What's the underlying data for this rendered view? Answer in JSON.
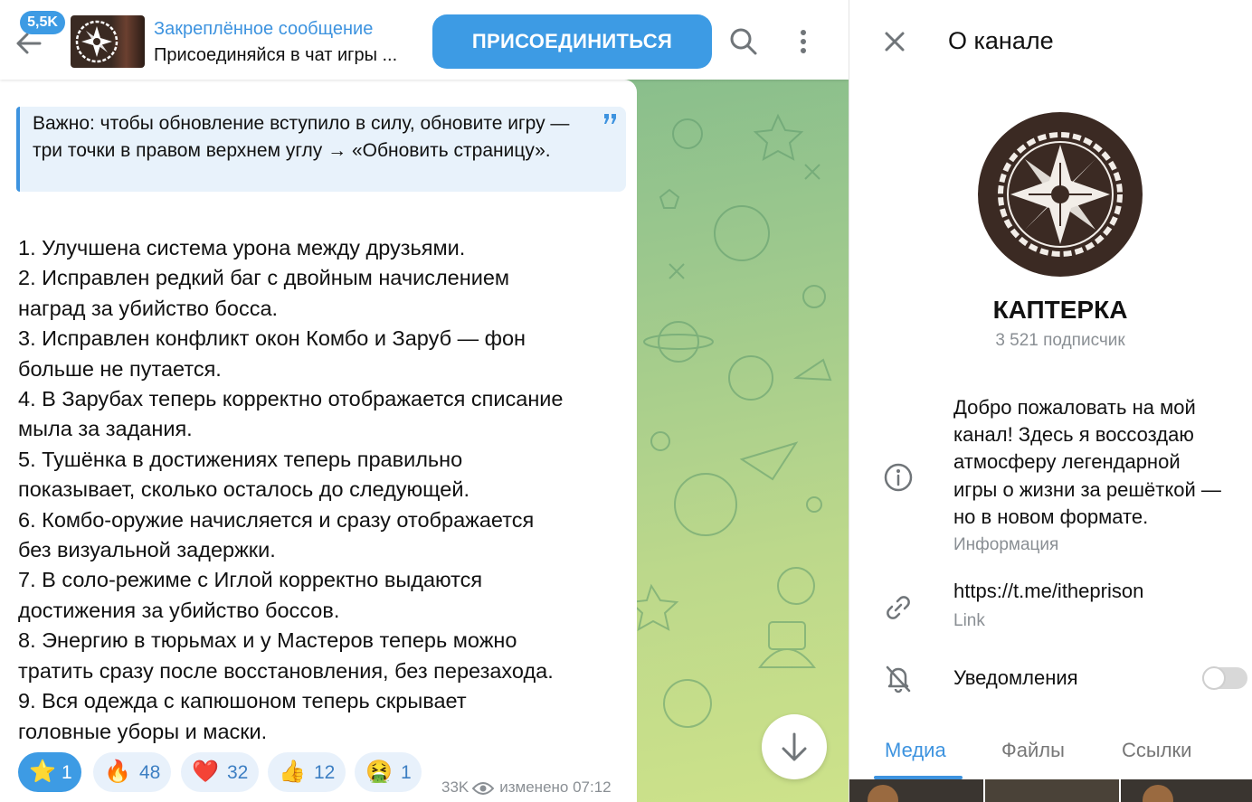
{
  "topbar": {
    "unread_count": "5,5K",
    "pinned_title": "Закреплённое сообщение",
    "pinned_preview": "Присоединяйся в чат игры ...",
    "join_label": "ПРИСОЕДИНИТЬСЯ",
    "icons": {
      "back": "arrow-left-icon",
      "search": "search-icon",
      "more": "more-vertical-icon"
    }
  },
  "message": {
    "quote": "Важно: чтобы обновление вступило в силу, обновите игру — три точки в правом верхнем углу → «Обновить страницу».",
    "lines": [
      "1. Улучшена система урона между друзьями.",
      "2. Исправлен редкий баг с двойным начислением",
      "наград за убийство босса.",
      "3. Исправлен конфликт окон Комбо и Заруб — фон",
      "больше не путается.",
      "4. В Зарубах теперь корректно отображается списание",
      "мыла за задания.",
      "5. Тушёнка в достижениях теперь правильно",
      "показывает, сколько осталось до следующей.",
      "6. Комбо-оружие начисляется и сразу отображается",
      "без визуальной задержки.",
      "7. В соло-режиме с Иглой корректно выдаются",
      "достижения за убийство боссов.",
      "8. Энергию в тюрьмах и у Мастеров теперь можно",
      "тратить сразу после восстановления, без перезахода.",
      "9. Вся одежда с капюшоном теперь скрывает",
      "головные уборы и маски."
    ],
    "reactions": [
      {
        "emoji": "⭐",
        "name": "star-reaction",
        "count": "1",
        "mine": true
      },
      {
        "emoji": "🔥",
        "name": "fire-reaction",
        "count": "48",
        "mine": false
      },
      {
        "emoji": "❤️",
        "name": "heart-reaction",
        "count": "32",
        "mine": false
      },
      {
        "emoji": "👍",
        "name": "thumbs-up-reaction",
        "count": "12",
        "mine": false
      },
      {
        "emoji": "🤮",
        "name": "vomit-reaction",
        "count": "1",
        "mine": false
      }
    ],
    "views": "33K",
    "edited": "изменено 07:12"
  },
  "panel": {
    "title": "О канале",
    "channel_name": "КАПТЕРКА",
    "subscribers": "3 521 подписчик",
    "description_lines": [
      "Добро пожаловать на мой",
      "канал! Здесь я воссоздаю",
      "атмосферу легендарной",
      "игры о жизни за решёткой —",
      "но в новом формате."
    ],
    "description_label": "Информация",
    "link": "https://t.me/itheprison",
    "link_label": "Link",
    "notifications_label": "Уведомления",
    "notifications_on": false,
    "tabs": [
      "Медиа",
      "Файлы",
      "Ссылки"
    ],
    "active_tab": "Медиа"
  },
  "colors": {
    "accent": "#3d9be4",
    "link_blue": "#3d93df",
    "avatar_bg": "#3b2a23"
  }
}
